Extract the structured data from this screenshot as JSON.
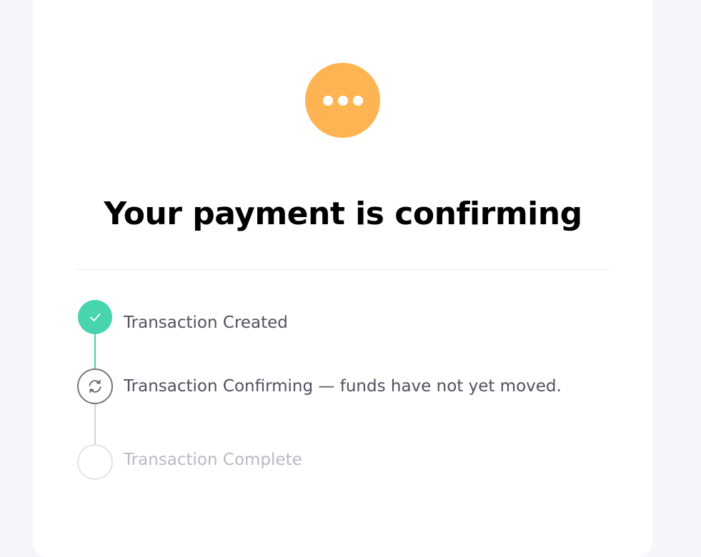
{
  "status": {
    "icon": "more-dots-icon",
    "color": "#ffb454"
  },
  "title": "Your payment is confirming",
  "steps": [
    {
      "label": "Transaction Created",
      "state": "done",
      "icon": "checkmark-icon",
      "color": "#48d4ae"
    },
    {
      "label": "Transaction Confirming — funds have not yet moved.",
      "state": "in-progress",
      "icon": "refresh-icon",
      "color": "#777777"
    },
    {
      "label": "Transaction Complete",
      "state": "pending",
      "icon": "empty-circle-icon",
      "color": "#b8bac2"
    }
  ],
  "colors": {
    "page_background": "#f5f6fa",
    "card_background": "#ffffff",
    "step_text": "#50525e",
    "connector_done": "#48d4ae",
    "connector_pending": "#d4d4d4"
  }
}
